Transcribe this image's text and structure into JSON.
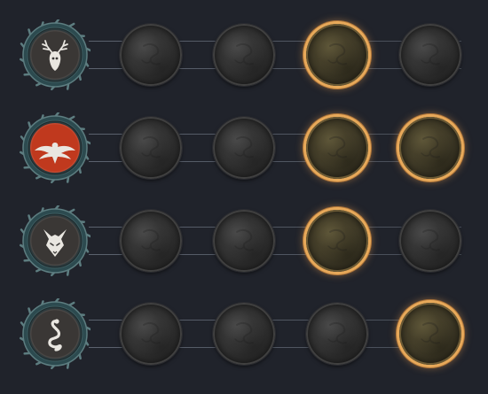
{
  "screen": {
    "background": "#20232b"
  },
  "spirits": [
    {
      "name": "deer-spirit",
      "icon": "deer-skull-icon",
      "emblem_color": "#3a3735",
      "nodes": [
        "locked",
        "locked",
        "locked",
        "unlocked",
        "locked"
      ]
    },
    {
      "name": "eagle-spirit",
      "icon": "eagle-icon",
      "emblem_color": "#c0391e",
      "nodes": [
        "locked",
        "locked",
        "locked",
        "unlocked",
        "unlocked"
      ]
    },
    {
      "name": "wolf-spirit",
      "icon": "wolf-head-icon",
      "emblem_color": "#3a3735",
      "nodes": [
        "locked",
        "locked",
        "locked",
        "unlocked",
        "locked"
      ]
    },
    {
      "name": "snake-spirit",
      "icon": "snake-icon",
      "emblem_color": "#3a3735",
      "nodes": [
        "locked",
        "locked",
        "locked",
        "locked",
        "unlocked"
      ]
    }
  ],
  "colors": {
    "frame": "#2c4a4f",
    "frame_edge": "#5d7d80",
    "active_ring": "#e7a95a"
  }
}
